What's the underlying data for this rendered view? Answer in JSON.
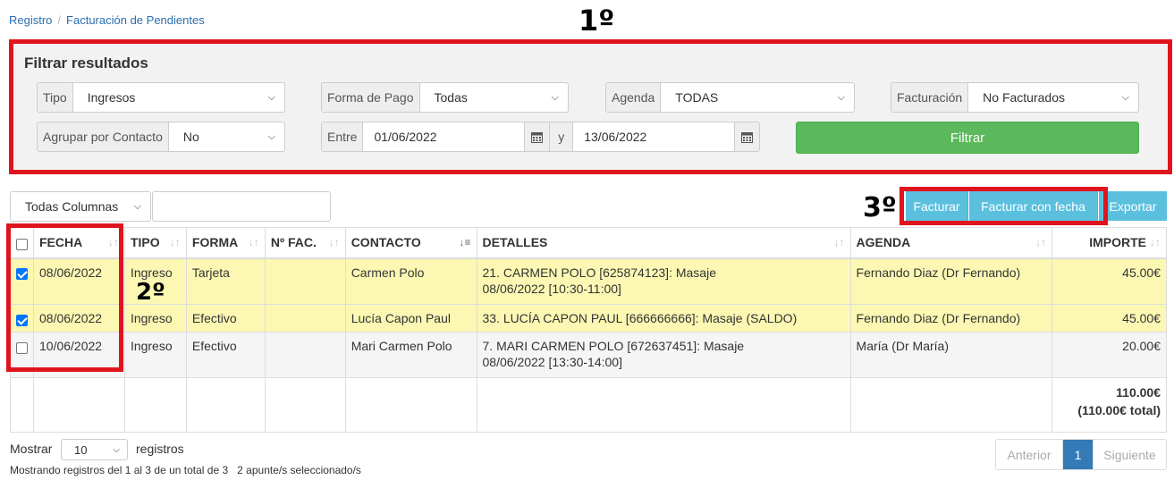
{
  "breadcrumb": {
    "home": "Registro",
    "separator": "/",
    "current": "Facturación de Pendientes"
  },
  "annotations": {
    "first": "1º",
    "second": "2º",
    "third": "3º"
  },
  "filter": {
    "title": "Filtrar resultados",
    "tipo": {
      "label": "Tipo",
      "value": "Ingresos"
    },
    "forma_pago": {
      "label": "Forma de Pago",
      "value": "Todas"
    },
    "agenda": {
      "label": "Agenda",
      "value": "TODAS"
    },
    "facturacion": {
      "label": "Facturación",
      "value": "No Facturados"
    },
    "agrupar": {
      "label": "Agrupar por Contacto",
      "value": "No"
    },
    "entre": {
      "label": "Entre",
      "from": "01/06/2022",
      "and_label": "y",
      "to": "13/06/2022"
    },
    "submit_label": "Filtrar"
  },
  "toolbar": {
    "column_select": "Todas Columnas",
    "search_value": "",
    "facturar": "Facturar",
    "facturar_fecha": "Facturar con fecha",
    "exportar": "Exportar"
  },
  "table": {
    "headers": [
      "FECHA",
      "TIPO",
      "FORMA",
      "Nº FAC.",
      "CONTACTO",
      "DETALLES",
      "AGENDA",
      "IMPORTE"
    ],
    "rows": [
      {
        "checked": true,
        "fecha": "08/06/2022",
        "tipo": "Ingreso",
        "forma": "Tarjeta",
        "nfac": "",
        "contacto": "Carmen Polo",
        "detalles_1": "21. CARMEN POLO [625874123]: Masaje",
        "detalles_2": "08/06/2022 [10:30-11:00]",
        "agenda": "Fernando Diaz (Dr Fernando)",
        "importe": "45.00€"
      },
      {
        "checked": true,
        "fecha": "08/06/2022",
        "tipo": "Ingreso",
        "forma": "Efectivo",
        "nfac": "",
        "contacto": "Lucía Capon Paul",
        "detalles_1": "33. LUCÍA CAPON PAUL [666666666]: Masaje (SALDO)",
        "detalles_2": "",
        "agenda": "Fernando Diaz (Dr Fernando)",
        "importe": "45.00€"
      },
      {
        "checked": false,
        "fecha": "10/06/2022",
        "tipo": "Ingreso",
        "forma": "Efectivo",
        "nfac": "",
        "contacto": "Mari Carmen Polo",
        "detalles_1": "7. MARI CARMEN POLO [672637451]: Masaje",
        "detalles_2": "08/06/2022 [13:30-14:00]",
        "agenda": "María (Dr María)",
        "importe": "20.00€"
      }
    ],
    "total": "110.00€",
    "total_all": "(110.00€ total)"
  },
  "footer": {
    "mostrar": "Mostrar",
    "page_length": "10",
    "registros": "registros",
    "info": "Mostrando registros del 1 al 3 de un total de 3",
    "selected": "2 apunte/s seleccionado/s",
    "prev": "Anterior",
    "page": "1",
    "next": "Siguiente"
  },
  "colors": {
    "highlight_row": "#fcf8b3",
    "filter_button": "#5cb85c",
    "action_button": "#5bc0de",
    "annotation_red": "#e0141e",
    "link": "#2a6eb0"
  }
}
